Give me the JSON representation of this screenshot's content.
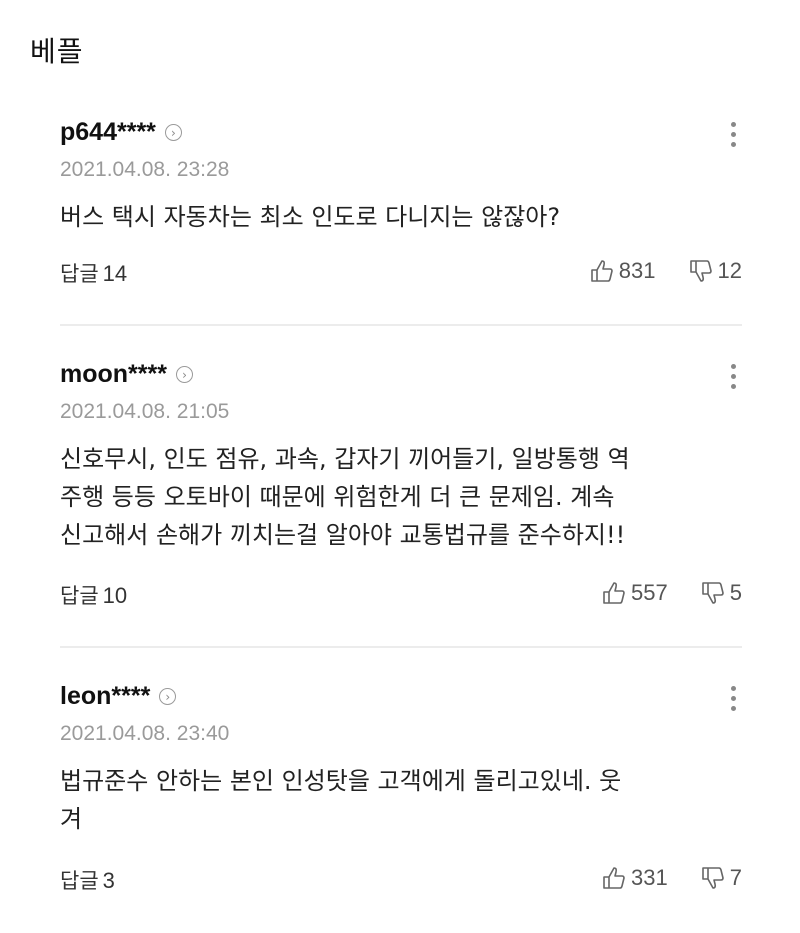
{
  "section": {
    "title": "베플"
  },
  "comments": [
    {
      "nickname": "p644****",
      "timestamp": "2021.04.08. 23:28",
      "text": "버스 택시 자동차는 최소 인도로 다니지는 않잖아?",
      "reply_label": "답글",
      "reply_count": "14",
      "likes": "831",
      "dislikes": "12"
    },
    {
      "nickname": "moon****",
      "timestamp": "2021.04.08. 21:05",
      "text": "신호무시, 인도 점유, 과속, 갑자기 끼어들기, 일방통행 역\n주행 등등 오토바이 때문에 위험한게 더 큰 문제임. 계속\n신고해서 손해가 끼치는걸 알아야 교통법규를 준수하지!!",
      "reply_label": "답글",
      "reply_count": "10",
      "likes": "557",
      "dislikes": "5"
    },
    {
      "nickname": "leon****",
      "timestamp": "2021.04.08. 23:40",
      "text": "법규준수 안하는 본인 인성탓을 고객에게 돌리고있네. 웃\n겨",
      "reply_label": "답글",
      "reply_count": "3",
      "likes": "331",
      "dislikes": "7"
    }
  ],
  "icons": {
    "profile": "chevron-right-circle-icon",
    "more": "more-vertical-icon",
    "like": "thumbs-up-icon",
    "dislike": "thumbs-down-icon"
  }
}
